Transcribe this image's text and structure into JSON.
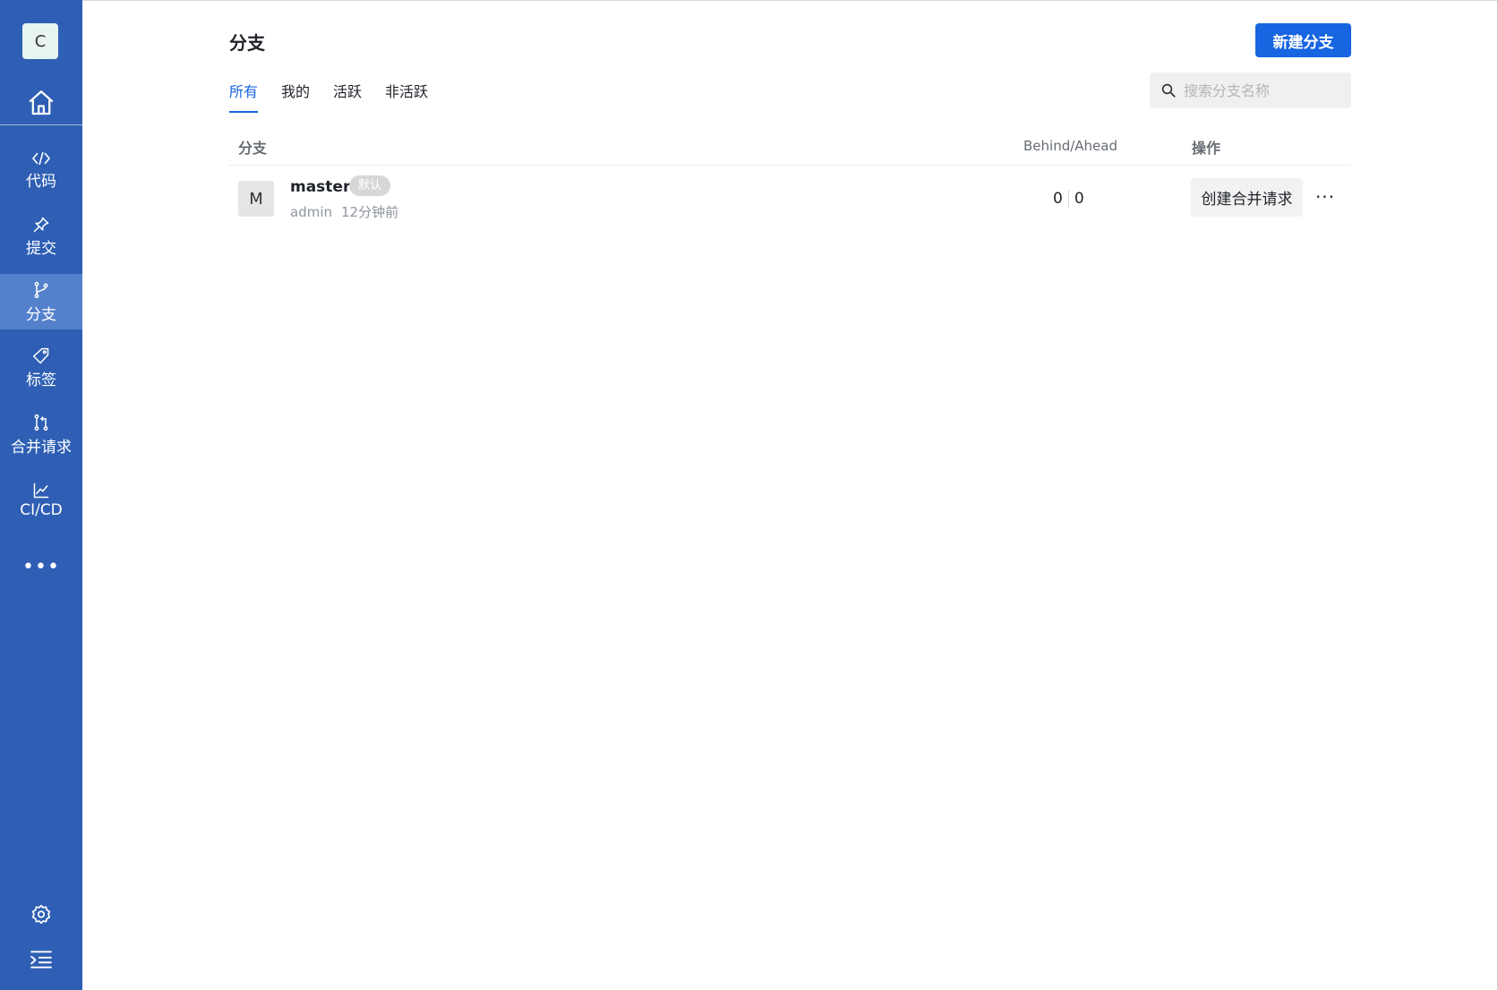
{
  "sidebar": {
    "repo_initial": "C",
    "items": [
      {
        "label": "代码",
        "icon": "code-icon"
      },
      {
        "label": "提交",
        "icon": "pin-icon"
      },
      {
        "label": "分支",
        "icon": "branch-icon",
        "active": true
      },
      {
        "label": "标签",
        "icon": "tag-icon"
      },
      {
        "label": "合并请求",
        "icon": "merge-request-icon"
      },
      {
        "label": "CI/CD",
        "icon": "chart-line-icon"
      }
    ],
    "more_label": "•••",
    "bottom_icons": [
      "gear-icon",
      "indent-menu-icon"
    ],
    "bg_color": "#2f5fb4",
    "active_color": "#5481cc"
  },
  "header": {
    "title": "分支",
    "new_button_label": "新建分支",
    "accent_color": "#1765e0"
  },
  "tabs": [
    {
      "label": "所有",
      "active": true
    },
    {
      "label": "我的"
    },
    {
      "label": "活跃"
    },
    {
      "label": "非活跃"
    }
  ],
  "search": {
    "placeholder": "搜索分支名称"
  },
  "table": {
    "columns": {
      "branch": "分支",
      "behind_ahead": "Behind/Ahead",
      "operations": "操作"
    },
    "rows": [
      {
        "avatar_initial": "M",
        "name": "master",
        "badge": "默认",
        "author": "admin",
        "time": "12分钟前",
        "behind": "0",
        "ahead": "0",
        "action_label": "创建合并请求",
        "more_label": "···"
      }
    ]
  }
}
